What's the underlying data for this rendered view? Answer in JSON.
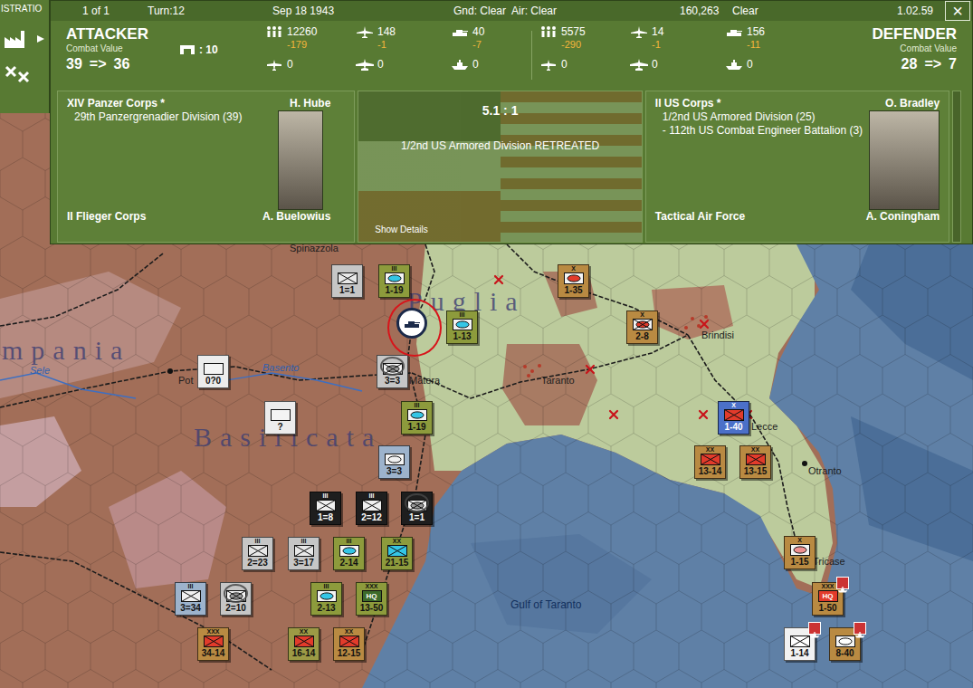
{
  "toolbar": {
    "title": "ISTRATIO"
  },
  "header": {
    "page": "1 of 1",
    "turn": "Turn:12",
    "date": "Sep 18 1943",
    "weather": "Gnd: Clear  Air: Clear",
    "score": "160,263",
    "conditions": "Clear",
    "version": "1.02.59",
    "close": "×"
  },
  "attacker": {
    "title": "ATTACKER",
    "cv_label": "Combat Value",
    "cv_before": "39",
    "arrow": "=>",
    "cv_after": "36",
    "entrenchment": ": 10",
    "stats": [
      {
        "kind": "men",
        "value": "12260",
        "loss": "-179"
      },
      {
        "kind": "fighter",
        "value": "148",
        "loss": "-1"
      },
      {
        "kind": "tank",
        "value": "40",
        "loss": "-7"
      },
      {
        "kind": "air",
        "value": "0"
      },
      {
        "kind": "bomber",
        "value": "0"
      },
      {
        "kind": "naval",
        "value": "0"
      }
    ],
    "corps": "XIV Panzer Corps *",
    "commander": "H. Hube",
    "units": [
      "29th Panzergrenadier Division (39)"
    ],
    "next_corps": "II Flieger Corps",
    "next_commander": "A. Buelowius"
  },
  "result": {
    "odds": "5.1 : 1",
    "message": "1/2nd US Armored Division RETREATED",
    "details": "Show Details"
  },
  "defender": {
    "title": "DEFENDER",
    "cv_label": "Combat Value",
    "cv_before": "28",
    "arrow": "=>",
    "cv_after": "7",
    "stats": [
      {
        "kind": "men",
        "value": "5575",
        "loss": "-290"
      },
      {
        "kind": "fighter",
        "value": "14",
        "loss": "-1"
      },
      {
        "kind": "tank",
        "value": "156",
        "loss": "-11"
      },
      {
        "kind": "air",
        "value": "0"
      },
      {
        "kind": "bomber",
        "value": "0"
      },
      {
        "kind": "naval",
        "value": "0"
      }
    ],
    "corps": "II US Corps *",
    "commander": "O. Bradley",
    "units": [
      "1/2nd US Armored Division (25)",
      "- 112th US Combat Engineer Battalion (3)"
    ],
    "next_corps": "Tactical Air Force",
    "next_commander": "A. Coningham"
  },
  "map": {
    "labels": [
      {
        "text": "Spinazzola",
        "kind": "town"
      },
      {
        "text": "Puglia",
        "kind": "region"
      },
      {
        "text": "mpania",
        "kind": "region"
      },
      {
        "text": "Basilicata",
        "kind": "region"
      },
      {
        "text": "Basento",
        "kind": "river"
      },
      {
        "text": "Sele",
        "kind": "river"
      },
      {
        "text": "Pot",
        "kind": "town"
      },
      {
        "text": "Matera",
        "kind": "town"
      },
      {
        "text": "Taranto",
        "kind": "town"
      },
      {
        "text": "Brindisi",
        "kind": "town"
      },
      {
        "text": "Lecce",
        "kind": "town"
      },
      {
        "text": "Otranto",
        "kind": "town"
      },
      {
        "text": "Tricase",
        "kind": "town"
      },
      {
        "text": "Gulf of Taranto",
        "kind": "sea"
      }
    ],
    "units": [
      {
        "label": "1=1",
        "kind": "infantry",
        "color": "#c6c6c6",
        "symbol_color": "#e8e8e8",
        "circled": false,
        "transport": false
      },
      {
        "label": "1-19",
        "kind": "armor",
        "color": "#8d9b3c",
        "symbol_color": "#34c6e6",
        "size": "III",
        "circled": false,
        "transport": false
      },
      {
        "label": "1-35",
        "kind": "armor",
        "color": "#b98a42",
        "symbol_color": "#e23b2b",
        "size": "X",
        "circled": false,
        "transport": false
      },
      {
        "label": "1-13",
        "kind": "armor",
        "color": "#8d9b3c",
        "symbol_color": "#34c6e6",
        "size": "III",
        "circled": false,
        "transport": false
      },
      {
        "label": "2-8",
        "kind": "mech",
        "color": "#b98a42",
        "symbol_color": "#e23b2b",
        "size": "X",
        "circled": false,
        "transport": false
      },
      {
        "label": "3=3",
        "kind": "mech",
        "color": "#c6c6c6",
        "symbol_color": "#9a9a9a",
        "circled": true,
        "transport": false
      },
      {
        "label": "1-19",
        "kind": "armor",
        "color": "#8d9b3c",
        "symbol_color": "#34c6e6",
        "size": "III",
        "circled": false,
        "transport": false
      },
      {
        "label": "1-40",
        "kind": "infantry",
        "color": "#4b70c8",
        "symbol_color": "#e23b2b",
        "size": "X",
        "circled": false,
        "transport": false
      },
      {
        "label": "13-14",
        "kind": "infantry",
        "color": "#b98a42",
        "symbol_color": "#e23b2b",
        "size": "XX",
        "circled": false,
        "transport": false
      },
      {
        "label": "13-15",
        "kind": "infantry",
        "color": "#b98a42",
        "symbol_color": "#e23b2b",
        "size": "XX",
        "circled": false,
        "transport": false
      },
      {
        "label": "3=3",
        "kind": "armor",
        "color": "#9db3cc",
        "symbol_color": "#f0f0f0",
        "circled": false,
        "transport": false
      },
      {
        "label": "1=8",
        "kind": "infantry",
        "color": "#1e1e1e",
        "symbol_color": "#f0f0f0",
        "size": "III",
        "circled": false,
        "transport": false
      },
      {
        "label": "2=12",
        "kind": "infantry",
        "color": "#1e1e1e",
        "symbol_color": "#f0f0f0",
        "size": "III",
        "circled": false,
        "transport": false
      },
      {
        "label": "1=1",
        "kind": "mech",
        "color": "#1e1e1e",
        "symbol_color": "#9a9a9a",
        "circled": true,
        "transport": false
      },
      {
        "label": "2=23",
        "kind": "infantry",
        "color": "#c6c6c6",
        "symbol_color": "#e8e8e8",
        "size": "III",
        "circled": false,
        "transport": false
      },
      {
        "label": "3=17",
        "kind": "infantry",
        "color": "#c6c6c6",
        "symbol_color": "#e8e8e8",
        "size": "III",
        "circled": false,
        "transport": false
      },
      {
        "label": "2-14",
        "kind": "armor",
        "color": "#8d9b3c",
        "symbol_color": "#34c6e6",
        "size": "III",
        "circled": false,
        "transport": false
      },
      {
        "label": "21-15",
        "kind": "infantry",
        "color": "#8d9b3c",
        "symbol_color": "#34c6e6",
        "size": "XX",
        "circled": false,
        "transport": false
      },
      {
        "label": "0?0",
        "kind": "unknown",
        "color": "#ececec",
        "symbol_color": "#ffffff",
        "circled": false,
        "transport": false
      },
      {
        "label": "?",
        "kind": "unknown",
        "color": "#ececec",
        "symbol_color": "#ffffff",
        "circled": false,
        "transport": false
      },
      {
        "label": "3=34",
        "kind": "infantry",
        "color": "#9db3cc",
        "symbol_color": "#f0f0f0",
        "size": "III",
        "circled": false,
        "transport": false
      },
      {
        "label": "2=10",
        "kind": "mech",
        "color": "#c6c6c6",
        "symbol_color": "#9a9a9a",
        "circled": true,
        "transport": false
      },
      {
        "label": "2-13",
        "kind": "armor",
        "color": "#8d9b3c",
        "symbol_color": "#34c6e6",
        "size": "III",
        "circled": false,
        "transport": false
      },
      {
        "label": "13-50",
        "kind": "hq",
        "color": "#8d9b3c",
        "symbol_color": "#3d6b2a",
        "size": "XXX",
        "badge": "HQ",
        "circled": false,
        "transport": false
      },
      {
        "label": "34-14",
        "kind": "infantry",
        "color": "#b98a42",
        "symbol_color": "#e23b2b",
        "size": "XXX",
        "circled": false,
        "transport": false
      },
      {
        "label": "16-14",
        "kind": "infantry",
        "color": "#9c9a45",
        "symbol_color": "#e23b2b",
        "size": "XX",
        "circled": false,
        "transport": false
      },
      {
        "label": "12-15",
        "kind": "infantry",
        "color": "#b98a42",
        "symbol_color": "#e23b2b",
        "size": "XX",
        "circled": false,
        "transport": false
      },
      {
        "label": "1-15",
        "kind": "armor",
        "color": "#b98a42",
        "symbol_color": "#ef8f8f",
        "size": "X",
        "circled": false,
        "transport": false
      },
      {
        "label": "1-50",
        "kind": "hq",
        "color": "#b98a42",
        "symbol_color": "#e23b2b",
        "size": "XXX",
        "badge": "HQ",
        "circled": false,
        "transport": true
      },
      {
        "label": "1-14",
        "kind": "infantry",
        "color": "#f2f2f2",
        "symbol_color": "#ffffff",
        "circled": false,
        "transport": true
      },
      {
        "label": "8-40",
        "kind": "armor",
        "color": "#b98a42",
        "symbol_color": "#ffffff",
        "circled": false,
        "transport": true
      }
    ],
    "marker": {
      "kind": "armor",
      "annotated": true
    }
  }
}
